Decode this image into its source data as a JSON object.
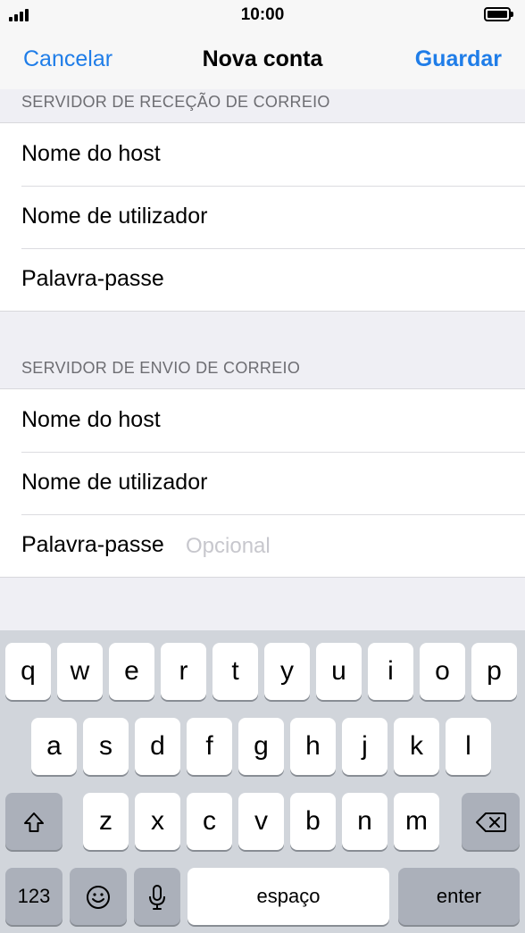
{
  "status_bar": {
    "time": "10:00"
  },
  "nav": {
    "cancel_label": "Cancelar",
    "title": "Nova conta",
    "save_label": "Guardar"
  },
  "incoming": {
    "header": "SERVIDOR DE RECEÇÃO DE CORREIO",
    "rows": [
      {
        "label": "Nome do host"
      },
      {
        "label": "Nome de utilizador"
      },
      {
        "label": "Palavra-passe"
      }
    ]
  },
  "outgoing": {
    "header": "SERVIDOR DE ENVIO DE CORREIO",
    "rows": [
      {
        "label": "Nome do host"
      },
      {
        "label": "Nome de utilizador"
      },
      {
        "label": "Palavra-passe",
        "placeholder": "Opcional"
      }
    ]
  },
  "keyboard": {
    "row1": [
      "q",
      "w",
      "e",
      "r",
      "t",
      "y",
      "u",
      "i",
      "o",
      "p"
    ],
    "row2": [
      "a",
      "s",
      "d",
      "f",
      "g",
      "h",
      "j",
      "k",
      "l"
    ],
    "row3": [
      "z",
      "x",
      "c",
      "v",
      "b",
      "n",
      "m"
    ],
    "shift_icon": "shift-icon",
    "delete_icon": "delete-icon",
    "numbers_label": "123",
    "emoji_icon": "emoji-icon",
    "mic_icon": "microphone-icon",
    "space_label": "espaço",
    "enter_label": "enter"
  },
  "colors": {
    "accent": "#1f7de8",
    "background": "#efeff4",
    "keyboard": "#d1d5db"
  }
}
